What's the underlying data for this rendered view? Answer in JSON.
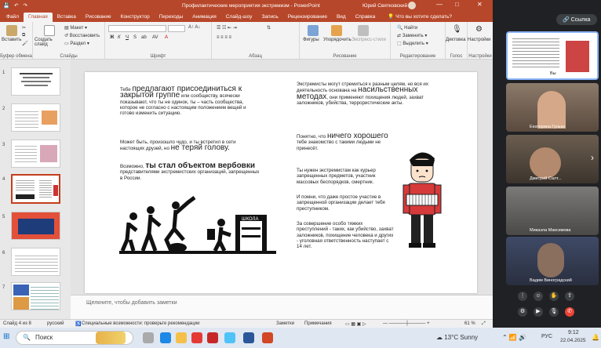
{
  "app": {
    "title": "Профилактические мероприятия экстремизм - PowerPoint",
    "user": "Юрий Святковский",
    "win_min": "—",
    "win_max": "□",
    "win_close": "✕"
  },
  "tabs": [
    "Файл",
    "Главная",
    "Вставка",
    "Рисование",
    "Конструктор",
    "Переходы",
    "Анимация",
    "Слайд-шоу",
    "Запись",
    "Рецензирование",
    "Вид",
    "Справка"
  ],
  "tell_me": "Что вы хотите сделать?",
  "ribbon": {
    "paste": "Вставить",
    "new_slide": "Создать слайд",
    "layout": "Макет",
    "reset": "Восстановить",
    "section": "Раздел",
    "shapes": "Фигуры",
    "arrange": "Упорядочить",
    "express": "Экспресс-стили",
    "find": "Найти",
    "replace": "Заменить",
    "select": "Выделить",
    "dictate": "Диктовка",
    "settings": "Настройки",
    "groups": {
      "clipboard": "Буфер обмена",
      "slides": "Слайды",
      "font": "Шрифт",
      "paragraph": "Абзац",
      "drawing": "Рисование",
      "editing": "Редактирование",
      "voice": "Голос",
      "settings": "Настройки"
    }
  },
  "thumbs": [
    "1",
    "2",
    "3",
    "4",
    "5",
    "6",
    "7"
  ],
  "slide": {
    "p1_a": "Тебе ",
    "p1_big": "предлагают присоединиться к закрытой группе",
    "p1_b": " или сообществу, всячески показывают, что ты не одинок, ты – часть сообщества, которое не согласно с настоящим положением вещей и готово изменить ситуацию.",
    "p2_a": "Может быть, произошло чудо, и ты встретил в сети настоящих друзей, но ",
    "p2_big": "не теряй голову.",
    "p3_a": "Возможно, ",
    "p3_big": "ты стал объектом вербовки",
    "p3_b": " представителями экстремистских организаций, запрещенных в России.",
    "r1_a": "Экстремисты могут стремиться к разным целям, но вся их деятельность основана на ",
    "r1_big": "насильственных методах",
    "r1_b": ", они применяют похищения людей, захват заложников, убийства, террористические акты.",
    "r2_a": "Понятно, что ",
    "r2_big": "ничего хорошего",
    "r2_b": " тебе знакомство с такими людьми не принесёт.",
    "r3": "Ты нужен экстремистам как курьер запрещенных предметов, участник массовых беспорядков, смертник.",
    "r4": "И помни, что даже простое участие в запрещенной организации делает тебя преступником.",
    "r5": "За совершение особо тяжких преступлений - таких, как убийство, захват заложников, похищение человека и других - уголовная ответственность наступает с 14 лет.",
    "school_sign": "ШКОЛА"
  },
  "notes_placeholder": "Щелкните, чтобы добавить заметки",
  "status": {
    "slide": "Слайд 4 из 8",
    "lang": "русский",
    "access": "Специальные возможности: проверьте рекомендации",
    "notes": "Заметки",
    "comments": "Примечания",
    "zoom": "61 %"
  },
  "meet": {
    "link_button": "Ссылка",
    "you_label": "Вы",
    "participants": [
      "Екатерина Гунько",
      "Дмитрий Салт...",
      "Микаэла Максимова",
      "Вадим Виноградский"
    ]
  },
  "taskbar": {
    "search": "Поиск",
    "weather": "13°C  Sunny",
    "lang": "РУС",
    "time": "9:12",
    "date": "22.04.2025"
  }
}
